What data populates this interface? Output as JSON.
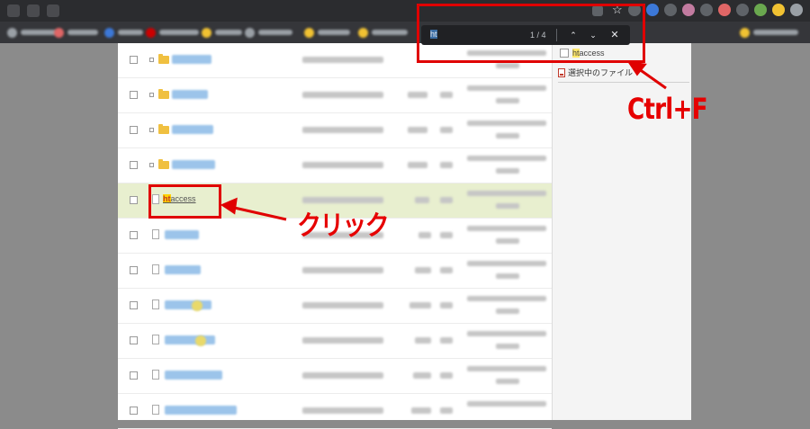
{
  "findbar": {
    "query": "ht",
    "match_count": "1 / 4",
    "prev_symbol": "⌃",
    "next_symbol": "⌄",
    "close_symbol": "✕"
  },
  "toolbar": {
    "star_symbol": "☆"
  },
  "file_list": {
    "selected_file": {
      "prefix": "ht",
      "rest": "access"
    }
  },
  "side_panel": {
    "file": {
      "prefix": "ht",
      "rest": "access"
    },
    "selected_files_label": "選択中のファイル"
  },
  "annotations": {
    "ctrl_f_label": "Ctrl+F",
    "click_label": "クリック"
  },
  "colors": {
    "annotation_red": "#e00000",
    "selected_row": "#e8efcf",
    "find_highlight": "#ffd400"
  }
}
